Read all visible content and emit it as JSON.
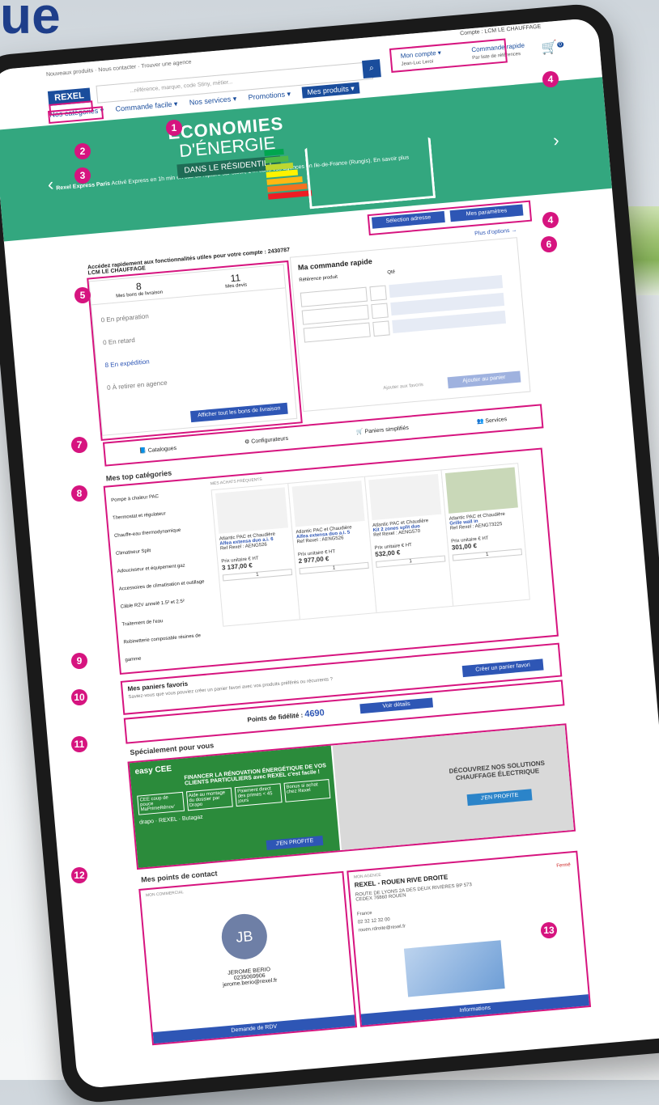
{
  "corner_title": "ue",
  "topbar": {
    "meta_links": "Nouveaux produits · Nous contacter · Trouver une agence",
    "logo": "REXEL",
    "search_placeholder": "...référence, marque, code Stiny, métier...",
    "search_icon": "search-icon",
    "client": "Compte : LCM LE CHAUFFAGE",
    "account_label": "Mon compte ▾",
    "account_sub": "Jean-Luc Leroi",
    "quick_label": "Commande rapide",
    "quick_sub": "Par liste de références",
    "cart_badge": "0"
  },
  "nav": {
    "categories": "Nos catégories ▾",
    "items": [
      "Commande facile ▾",
      "Nos services ▾",
      "Promotions ▾",
      "Mes produits ▾"
    ],
    "switch_label": "Rexel Express Paris",
    "switch_text": "Activé Express en 1h min en cas de rupture sur stock, 14h dans vos agences en Ile-de-France (Rungis). En savoir plus"
  },
  "hero": {
    "line1": "ÉCONOMIES",
    "line2": "D'ÉNERGIE",
    "line3": "DANS LE RÉSIDENTIEL",
    "energy_colors": [
      "#00a64f",
      "#50b848",
      "#bed730",
      "#fff200",
      "#fdb913",
      "#f37021",
      "#ed1c24"
    ]
  },
  "actions": {
    "address": "Sélection adresse",
    "params": "Mes paramètres"
  },
  "shortcuts": {
    "text": "Accédez rapidement aux fonctionnalités utiles pour votre compte : 2430787 LCM LE CHAUFFAGE",
    "more": "Plus d'options →"
  },
  "orders": {
    "tabs": [
      {
        "count": "8",
        "label": "Mes bons de livraison"
      },
      {
        "count": "11",
        "label": "Mes devis"
      }
    ],
    "rows": [
      {
        "count": "0",
        "label": "En préparation"
      },
      {
        "count": "0",
        "label": "En retard"
      },
      {
        "count": "8",
        "label": "En expédition"
      },
      {
        "count": "0",
        "label": "À retirer en agence"
      }
    ],
    "cta": "Afficher tout les bons de livraison"
  },
  "quick_order": {
    "title": "Ma commande rapide",
    "col1": "Référence produit",
    "col2": "Qté",
    "favorite": "Ajouter aux favoris",
    "add_cart": "Ajouter au panier"
  },
  "tiles": [
    "Catalogues",
    "Configurateurs",
    "Paniers simplifiés",
    "Services"
  ],
  "top_categories": {
    "title": "Mes top catégories",
    "list": [
      "Pompe à chaleur PAC",
      "Thermostat et régulateur",
      "Chauffe-eau thermodynamique",
      "Climatiseur Split",
      "Adoucisseur et équipement gaz",
      "Accessoires de climatisation et outillage",
      "Câble R2V annelé 1.5² et 2.5²",
      "Traitement de l'eau",
      "Robinetterie composable résines de gamme"
    ],
    "panel_label": "MES ACHATS FRÉQUENTS",
    "products": [
      {
        "brand": "Atlantic PAC et Chaudière",
        "name": "Alfea extensa duo a.i. 6",
        "ref": "Ref Rexel : AENG526",
        "price": "3 137,00 €",
        "unit": "Prix unitaire € HT"
      },
      {
        "brand": "Atlantic PAC et Chaudière",
        "name": "Alfea extensa duo a.i. 5",
        "ref": "Ref Rexel : AENG526",
        "price": "2 977,00 €",
        "unit": "Prix unitaire € HT"
      },
      {
        "brand": "Atlantic PAC et Chaudière",
        "name": "Kit 2 zones split duo",
        "ref": "Ref Rexel : AENG570",
        "price": "532,00 €",
        "unit": "Prix unitaire € HT"
      },
      {
        "brand": "Atlantic PAC et Chaudière",
        "name": "Grille wall in",
        "ref": "Ref Rexel : AENG73225",
        "price": "301,00 €",
        "unit": "Prix unitaire € HT"
      }
    ],
    "qty": "1"
  },
  "favorites": {
    "title": "Mes paniers favoris",
    "text": "Saviez-vous que vous pouviez créer un panier favori avec vos produits préférés ou récurrents ?",
    "cta": "Créer un panier favori"
  },
  "loyalty": {
    "label": "Points de fidélité :",
    "value": "4690",
    "cta": "Voir détails"
  },
  "special": {
    "title": "Spécialement pour vous",
    "left_brand": "easy CEE",
    "left_headline": "FINANCER LA RÉNOVATION ÉNERGÉTIQUE DE VOS CLIENTS PARTICULIERS avec REXEL c'est facile !",
    "left_boxes": [
      "CEE coup de pouce MaPrimeRénov'",
      "Aide au montage du dossier par Drapo",
      "Paiement direct des primes < 45 jours",
      "Bonus si achat chez Rexel"
    ],
    "left_cta": "J'EN PROFITE",
    "partners": [
      "drapo",
      "REXEL",
      "Butagaz"
    ],
    "right_headline": "DÉCOUVREZ NOS SOLUTIONS CHAUFFAGE ÉLECTRIQUE",
    "right_cta": "J'EN PROFITE"
  },
  "contact": {
    "title": "Mes points de contact",
    "label": "MON COMMERCIAL",
    "initials": "JB",
    "name": "JEROME BERIO",
    "phone": "0235069906",
    "email": "jerome.berio@rexel.fr",
    "cta": "Demande de RDV"
  },
  "agency": {
    "label": "MON AGENCE",
    "name": "REXEL - ROUEN RIVE DROITE",
    "status": "Fermé",
    "address": "ROUTE DE LYONS 2A DES DEUX RIVIÈRES BP 573 CEDEX 76860 ROUEN",
    "country": "France",
    "phone": "02 32 12 32 00",
    "email": "rouen.rdroite@rexel.fr",
    "cta": "Informations"
  }
}
